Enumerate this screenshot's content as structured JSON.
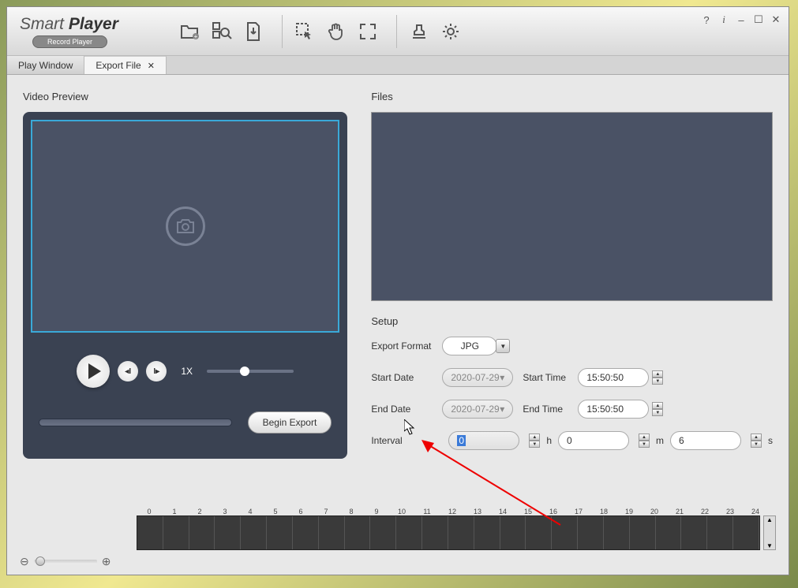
{
  "app": {
    "title_a": "Smart",
    "title_b": "Player",
    "subtitle": "Record Player"
  },
  "win_controls": {
    "help": "?",
    "info": "i",
    "min": "–",
    "max": "☐",
    "close": "✕"
  },
  "tabs": {
    "play": "Play Window",
    "export": "Export File"
  },
  "preview": {
    "title": "Video Preview",
    "speed": "1X",
    "export_btn": "Begin Export"
  },
  "files": {
    "title": "Files"
  },
  "setup": {
    "title": "Setup",
    "format_label": "Export Format",
    "format_value": "JPG",
    "start_date_label": "Start Date",
    "start_date": "2020-07-29",
    "start_time_label": "Start Time",
    "start_time": "15:50:50",
    "end_date_label": "End Date",
    "end_date": "2020-07-29",
    "end_time_label": "End Time",
    "end_time": "15:50:50",
    "interval_label": "Interval",
    "hours": "0",
    "h": "h",
    "mins": "0",
    "m": "m",
    "secs": "6",
    "s": "s"
  },
  "timeline": {
    "hours": [
      "0",
      "1",
      "2",
      "3",
      "4",
      "5",
      "6",
      "7",
      "8",
      "9",
      "10",
      "11",
      "12",
      "13",
      "14",
      "15",
      "16",
      "17",
      "18",
      "19",
      "20",
      "21",
      "22",
      "23",
      "24"
    ]
  }
}
